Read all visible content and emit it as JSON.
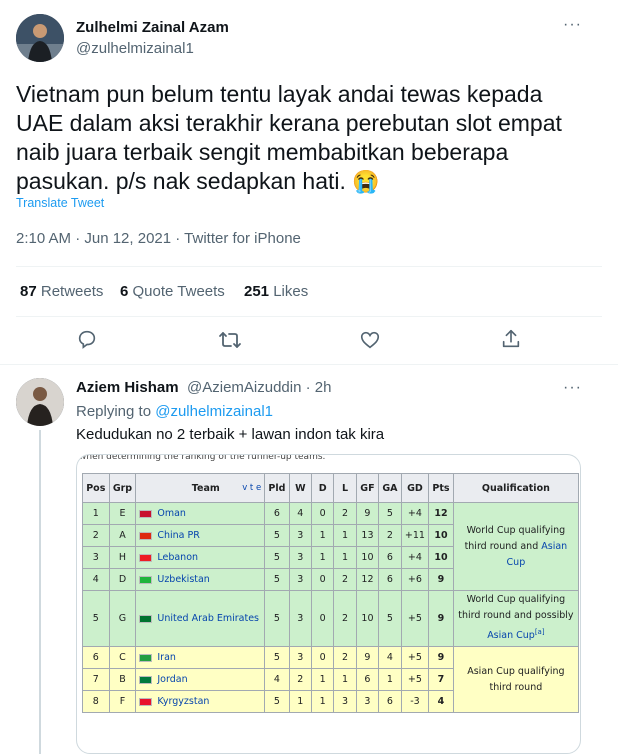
{
  "tweet": {
    "author_name": "Zulhelmi Zainal Azam",
    "author_handle": "@zulhelmizainal1",
    "more": "···",
    "text_line1": "Vietnam pun belum tentu layak andai tewas kepada",
    "text_line2": "UAE dalam aksi terakhir kerana perebutan slot empat",
    "text_line3": "naib juara terbaik sengit membabitkan beberapa",
    "text_line4": "pasukan. p/s nak sedapkan hati.",
    "emoji": "😭",
    "translate": "Translate Tweet",
    "timestamp": "2:10 AM · Jun 12, 2021 · Twitter for iPhone",
    "retweets_count": "87",
    "retweets_label": "Retweets",
    "quotes_count": "6",
    "quotes_label": "Quote Tweets",
    "likes_count": "251",
    "likes_label": "Likes"
  },
  "actions": [
    "reply-icon",
    "retweet-icon",
    "like-icon",
    "share-icon"
  ],
  "reply": {
    "author_name": "Aziem Hisham",
    "author_handle": "@AziemAizuddin · 2h",
    "more": "···",
    "replying_prefix": "Replying to",
    "replying_handle": "@zulhelmizainal1",
    "text": "Kedudukan no 2 terbaik + lawan indon tak kira"
  },
  "standings": {
    "caption": "when determining the ranking of the runner-up teams.",
    "headers": [
      "Pos",
      "Grp",
      "Team",
      "Pld",
      "W",
      "D",
      "L",
      "GF",
      "GA",
      "GD",
      "Pts",
      "Qualification"
    ],
    "vte": "v t e",
    "rows": [
      {
        "pos": "1",
        "grp": "E",
        "team": "Oman",
        "pld": "6",
        "w": "4",
        "d": "0",
        "l": "2",
        "gf": "9",
        "ga": "5",
        "gd": "+4",
        "pts": "12",
        "flag": "#c8102e"
      },
      {
        "pos": "2",
        "grp": "A",
        "team": "China PR",
        "pld": "5",
        "w": "3",
        "d": "1",
        "l": "1",
        "gf": "13",
        "ga": "2",
        "gd": "+11",
        "pts": "10",
        "flag": "#de2910"
      },
      {
        "pos": "3",
        "grp": "H",
        "team": "Lebanon",
        "pld": "5",
        "w": "3",
        "d": "1",
        "l": "1",
        "gf": "10",
        "ga": "6",
        "gd": "+4",
        "pts": "10",
        "flag": "#ed1c24"
      },
      {
        "pos": "4",
        "grp": "D",
        "team": "Uzbekistan",
        "pld": "5",
        "w": "3",
        "d": "0",
        "l": "2",
        "gf": "12",
        "ga": "6",
        "gd": "+6",
        "pts": "9",
        "flag": "#1eb53a"
      },
      {
        "pos": "5",
        "grp": "G",
        "team": "United Arab Emirates",
        "pld": "5",
        "w": "3",
        "d": "0",
        "l": "2",
        "gf": "10",
        "ga": "5",
        "gd": "+5",
        "pts": "9",
        "flag": "#00732f"
      },
      {
        "pos": "6",
        "grp": "C",
        "team": "Iran",
        "pld": "5",
        "w": "3",
        "d": "0",
        "l": "2",
        "gf": "9",
        "ga": "4",
        "gd": "+5",
        "pts": "9",
        "flag": "#239f40"
      },
      {
        "pos": "7",
        "grp": "B",
        "team": "Jordan",
        "pld": "4",
        "w": "2",
        "d": "1",
        "l": "1",
        "gf": "6",
        "ga": "1",
        "gd": "+5",
        "pts": "7",
        "flag": "#007a3d"
      },
      {
        "pos": "8",
        "grp": "F",
        "team": "Kyrgyzstan",
        "pld": "5",
        "w": "1",
        "d": "1",
        "l": "3",
        "gf": "3",
        "ga": "6",
        "gd": "-3",
        "pts": "4",
        "flag": "#e8112d"
      }
    ],
    "qual_a_pre": "World Cup qualifying third round",
    "qual_a_and": "and",
    "qual_a_link": "Asian Cup",
    "qual_b_pre": "World Cup qualifying third round and possibly",
    "qual_b_link": "Asian Cup",
    "qual_b_note": "[a]",
    "qual_c": "Asian Cup qualifying third round",
    "green_color": "#ccf0cc",
    "yellow_color": "#ffffc4"
  },
  "colors": {
    "accent": "#1d9bf0",
    "text": "#0f1419",
    "muted": "#536471"
  }
}
